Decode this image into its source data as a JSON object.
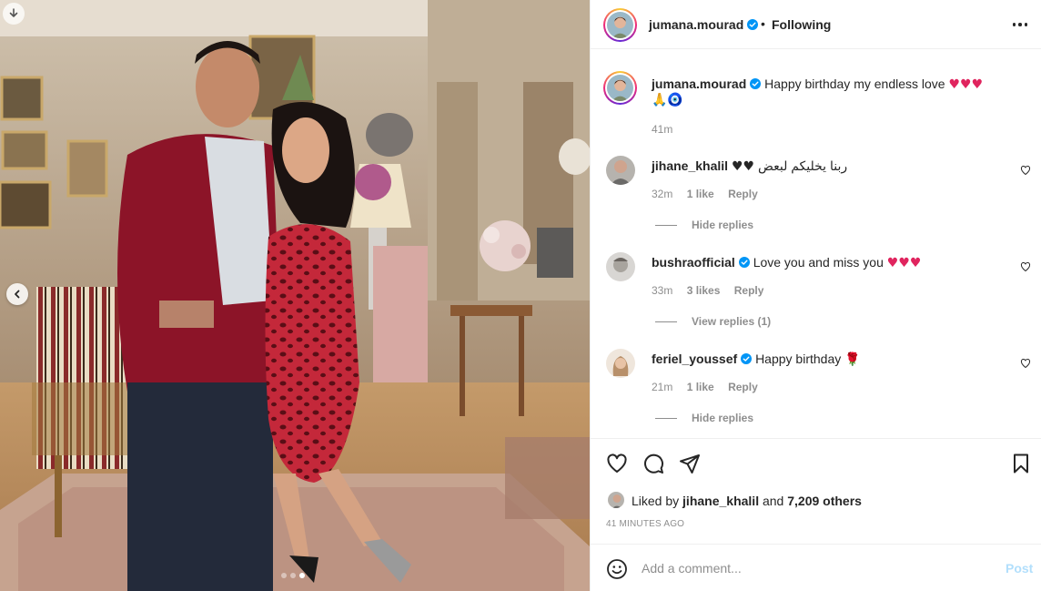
{
  "post": {
    "author": "jumana.mourad",
    "follow_separator": "•",
    "follow_status": "Following",
    "caption_text": "Happy birthday my endless love",
    "caption_emojis_line1": "♥♥♥",
    "caption_emojis_line2": "🙏🧿",
    "caption_time": "41m"
  },
  "comments": [
    {
      "user": "jihane_khalil",
      "text": "ربنا يخليكم لبعض",
      "emoji": "♥♥",
      "time": "32m",
      "likes": "1 like",
      "reply": "Reply",
      "replies_toggle": "Hide replies"
    },
    {
      "user": "bushraofficial",
      "text": "Love you and miss you",
      "emoji": "♥♥♥",
      "time": "33m",
      "likes": "3 likes",
      "reply": "Reply",
      "replies_toggle": "View replies (1)"
    },
    {
      "user": "feriel_youssef",
      "text": "Happy birthday",
      "emoji": "🌹",
      "time": "21m",
      "likes": "1 like",
      "reply": "Reply",
      "replies_toggle": "Hide replies"
    }
  ],
  "likes": {
    "prefix": "Liked by",
    "user": "jihane_khalil",
    "conjunction": "and",
    "others": "7,209 others"
  },
  "timestamp": "41 minutes ago",
  "add_comment": {
    "placeholder": "Add a comment...",
    "post_label": "Post"
  },
  "carousel": {
    "count": 3,
    "active_index": 2
  },
  "colors": {
    "text": "#262626",
    "secondary": "#8e8e8e",
    "verified": "#0095f6",
    "post_disabled": "#b2dffc",
    "heart": "#e0245e"
  },
  "icons": [
    "download-icon",
    "chevron-left-icon",
    "verified-icon",
    "more-icon",
    "heart-icon",
    "comment-icon",
    "share-icon",
    "bookmark-icon",
    "emoji-icon"
  ]
}
